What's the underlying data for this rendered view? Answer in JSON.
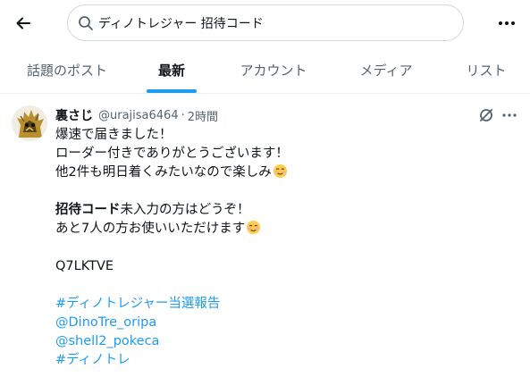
{
  "search": {
    "query": "ディノトレジャー 招待コード"
  },
  "tabs": [
    {
      "label": "話題のポスト"
    },
    {
      "label": "最新"
    },
    {
      "label": "アカウント"
    },
    {
      "label": "メディア"
    },
    {
      "label": "リスト"
    }
  ],
  "tweet": {
    "display_name": "裏さじ",
    "handle": "@urajisa6464",
    "separator": "·",
    "time": "2時間",
    "lines": {
      "l1": "爆速で届きました！",
      "l2": "ローダー付きでありがとうございます！",
      "l3": "他2件も明日着くみたいなので楽しみ",
      "l4_bold": "招待コード",
      "l4_rest": "未入力の方はどうぞ！",
      "l5": "あと7人の方お使いいただけます",
      "l6": "Q7LKTVE"
    },
    "links": [
      "#ディノトレジャー当選報告",
      "@DinoTre_oripa",
      "@shell2_pokeca",
      "#ディノトレ"
    ]
  },
  "colors": {
    "accent": "#1d9bf0",
    "muted": "#536471",
    "text": "#0f1419"
  },
  "icons": [
    "back-arrow-icon",
    "search-icon",
    "more-icon",
    "grok-icon",
    "more-horizontal-icon",
    "smiling-face-emoji",
    "relieved-face-emoji"
  ]
}
